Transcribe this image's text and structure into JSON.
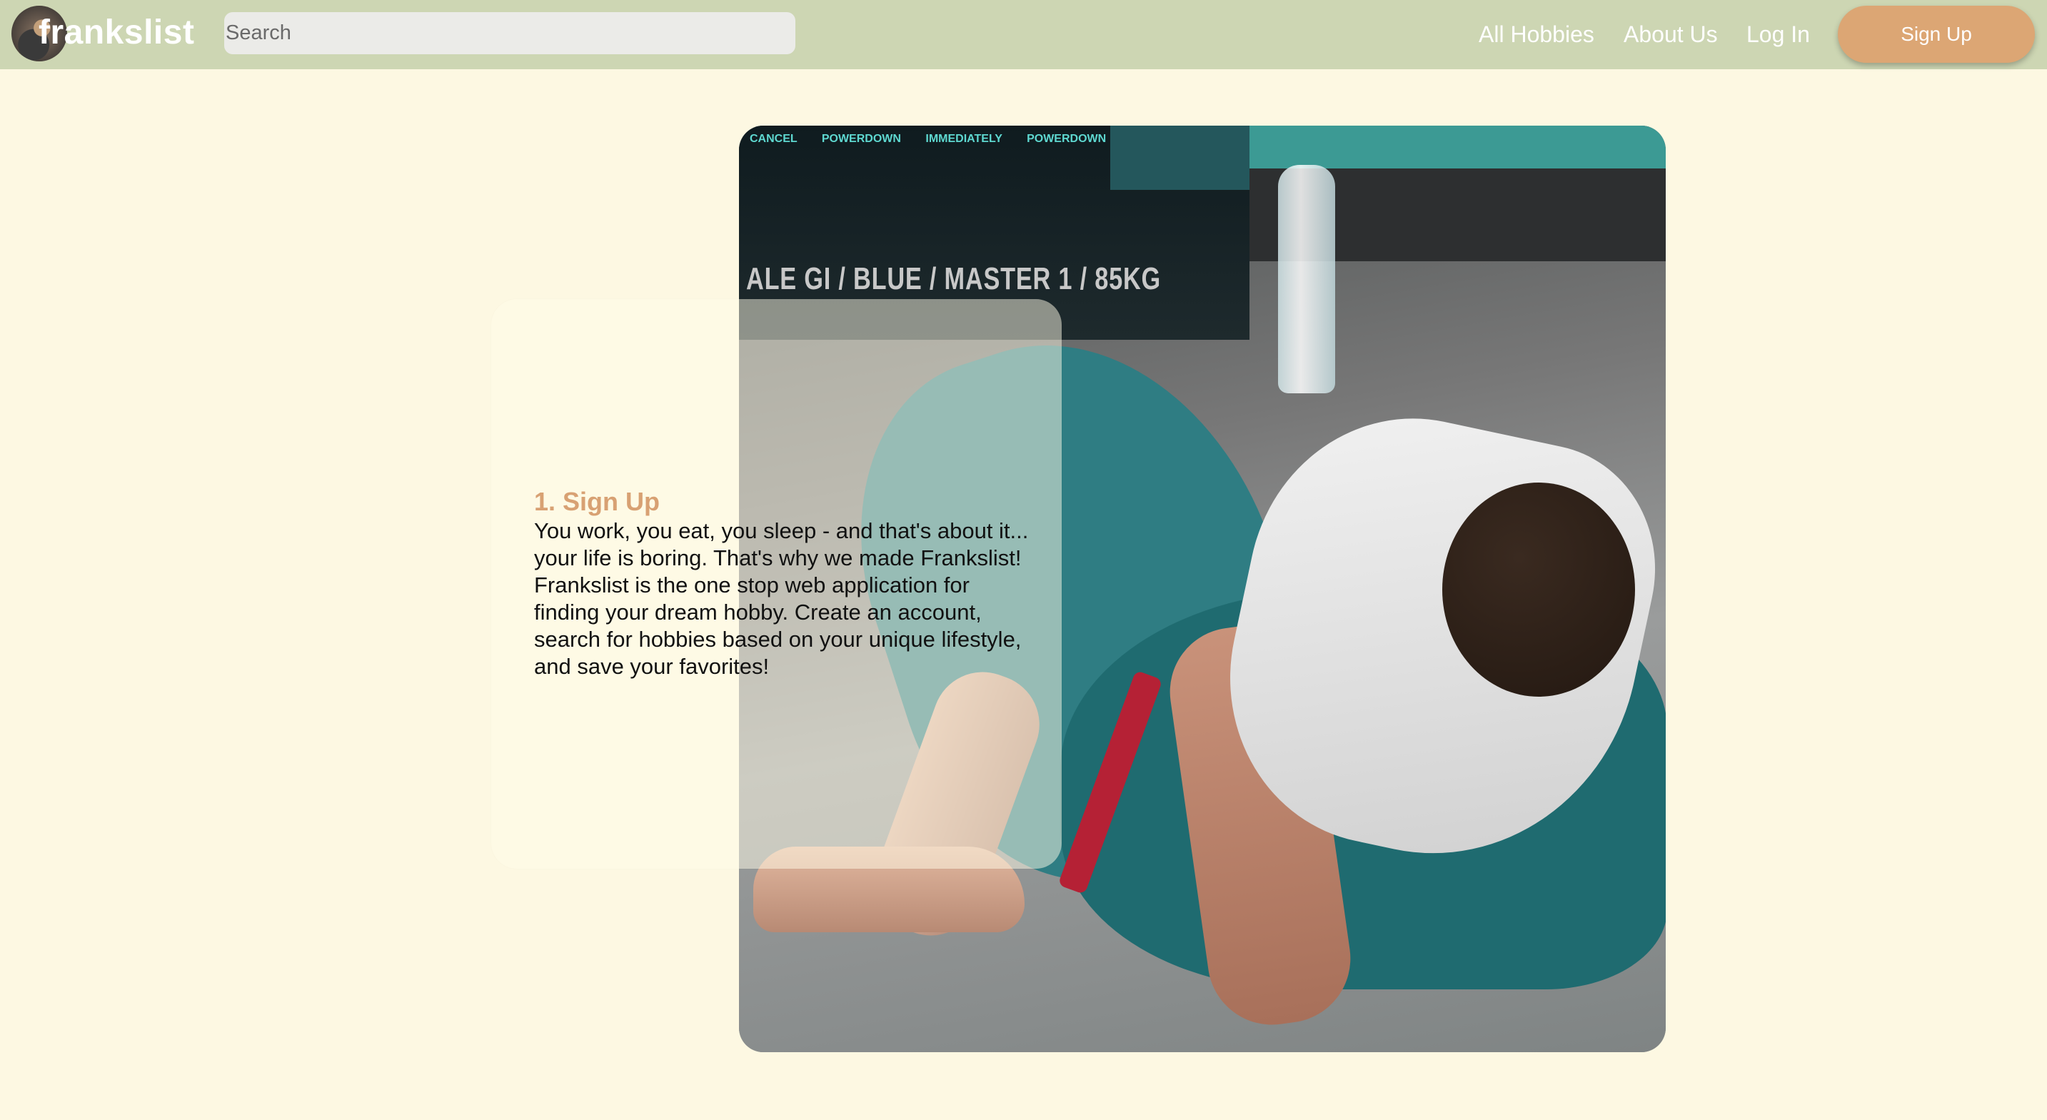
{
  "header": {
    "brand": "frankslist",
    "search_placeholder": "Search",
    "nav": {
      "all_hobbies": "All Hobbies",
      "about_us": "About Us",
      "log_in": "Log In",
      "sign_up": "Sign Up"
    }
  },
  "hero": {
    "photo": {
      "subject": "jiu-jitsu-grappling-photo",
      "scoreboard_top": "CANCEL POWERDOWN IMMEDIATELY POWERDOWN",
      "scoreboard_text": "ALE GI / BLUE / MASTER 1 / 85KG"
    },
    "card": {
      "title": "1. Sign Up",
      "body": "You work, you eat, you sleep - and that's about it... your life is boring. That's why we made Frankslist! Frankslist is the one stop web application for finding your dream hobby. Create an account, search for hobbies based on your unique lifestyle, and save your favorites!"
    }
  },
  "colors": {
    "header_bg": "#cdd6b3",
    "page_bg": "#fdf8e2",
    "accent": "#dca674",
    "title_accent": "#d8a173"
  }
}
